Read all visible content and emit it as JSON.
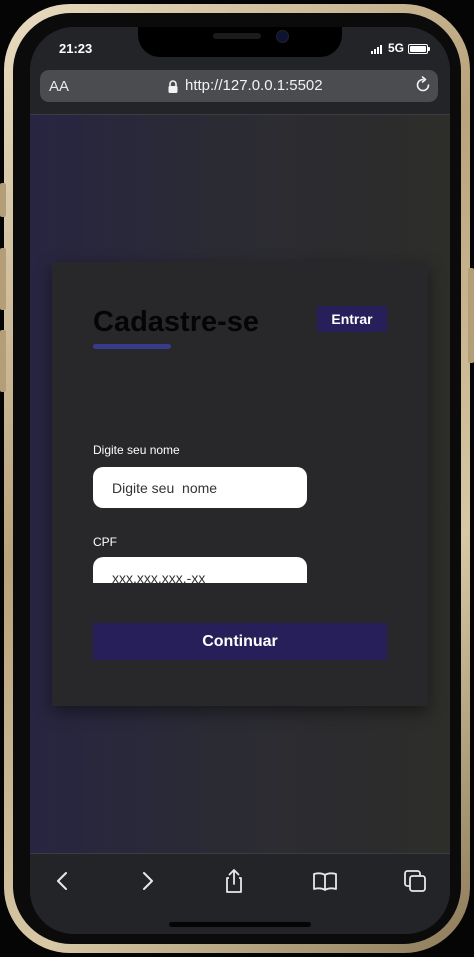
{
  "status_bar": {
    "time": "21:23",
    "network": "5G"
  },
  "browser": {
    "text_size_label": "AA",
    "url": "http://127.0.0.1:5502"
  },
  "page": {
    "title": "Cadastre-se",
    "login_button": "Entrar",
    "name_label": "Digite seu nome",
    "name_placeholder": "Digite seu  nome",
    "cpf_label": "CPF",
    "cpf_placeholder": "xxx.xxx.xxx.-xx",
    "continue_button": "Continuar"
  },
  "colors": {
    "accent": "#271f5a",
    "underline": "#3a3a8c"
  },
  "icons": [
    "lock-icon",
    "reload-icon",
    "back-icon",
    "forward-icon",
    "share-icon",
    "bookmarks-icon",
    "tabs-icon"
  ]
}
